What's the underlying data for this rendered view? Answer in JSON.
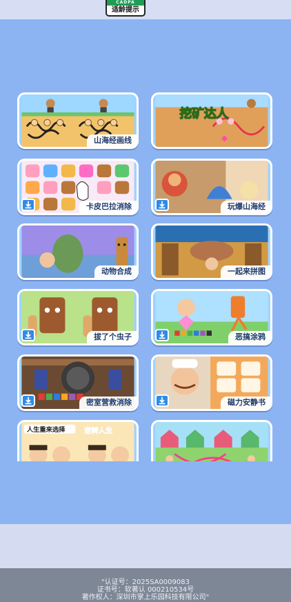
{
  "age_badge": {
    "top": "CADPA",
    "label": "适龄提示"
  },
  "games": [
    {
      "title": "山海经画线",
      "download": false
    },
    {
      "title": "挖矿达人",
      "download": false
    },
    {
      "title": "卡皮巴拉消除",
      "download": true
    },
    {
      "title": "玩爆山海经",
      "download": true
    },
    {
      "title": "动物合成",
      "download": false
    },
    {
      "title": "一起来拼图",
      "download": false
    },
    {
      "title": "拔了个虫子",
      "download": true
    },
    {
      "title": "恶搞涂鸦",
      "download": true
    },
    {
      "title": "密室营救消除",
      "download": true
    },
    {
      "title": "磁力安静书",
      "download": true
    },
    {
      "title": "人生重来选择",
      "caption2": "逆转人生",
      "download": false
    },
    {
      "title": "",
      "download": false
    }
  ],
  "art_text": {
    "mining_title": "挖矿达人"
  },
  "footer": {
    "line1": "\"认证号：2025SA0009083",
    "line2": "证书号：软著认 000210534号",
    "line3": "著作权人：深圳市掌上乐园科技有限公司\""
  }
}
